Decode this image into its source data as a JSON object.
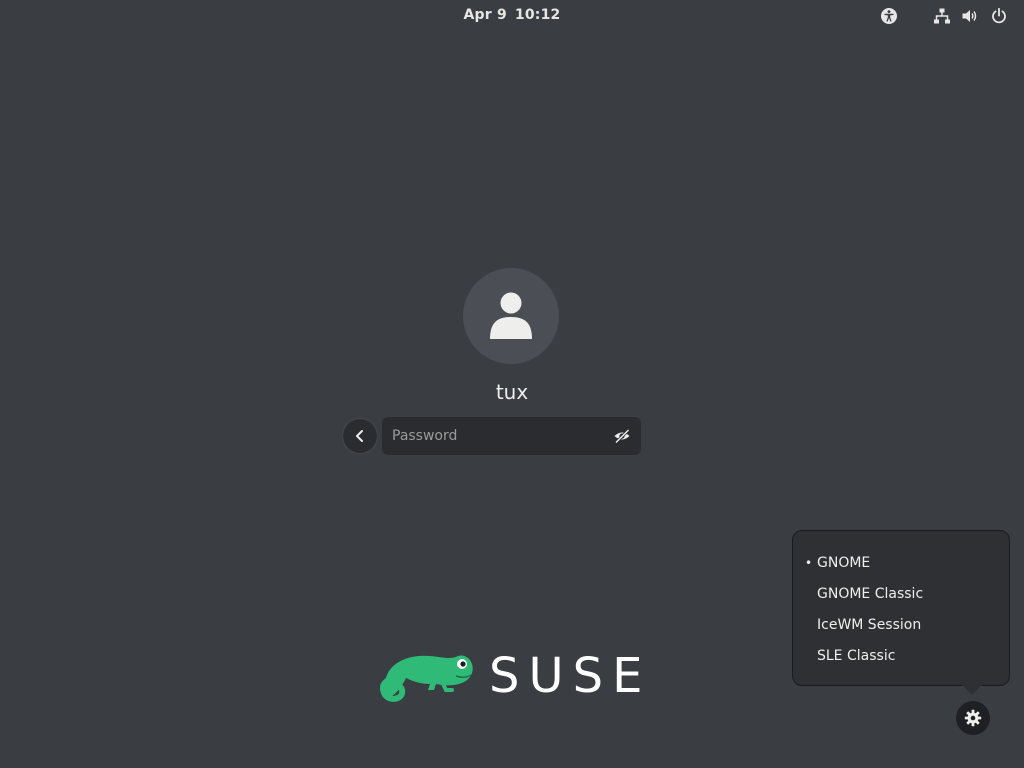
{
  "topbar": {
    "date": "Apr 9",
    "time": "10:12",
    "icons": [
      "accessibility-icon",
      "network-icon",
      "volume-icon",
      "power-icon"
    ]
  },
  "login": {
    "username": "tux",
    "password_placeholder": "Password",
    "password_value": ""
  },
  "logo": {
    "text": "SUSE",
    "color": "#30ba78"
  },
  "session_menu": {
    "items": [
      {
        "label": "GNOME",
        "selected": true,
        "bullet": "•"
      },
      {
        "label": "GNOME Classic",
        "selected": false,
        "bullet": ""
      },
      {
        "label": "IceWM Session",
        "selected": false,
        "bullet": ""
      },
      {
        "label": "SLE Classic",
        "selected": false,
        "bullet": ""
      }
    ]
  },
  "colors": {
    "background": "#3a3d42",
    "entry_bg": "#2b2c30",
    "brand_green": "#30ba78"
  }
}
